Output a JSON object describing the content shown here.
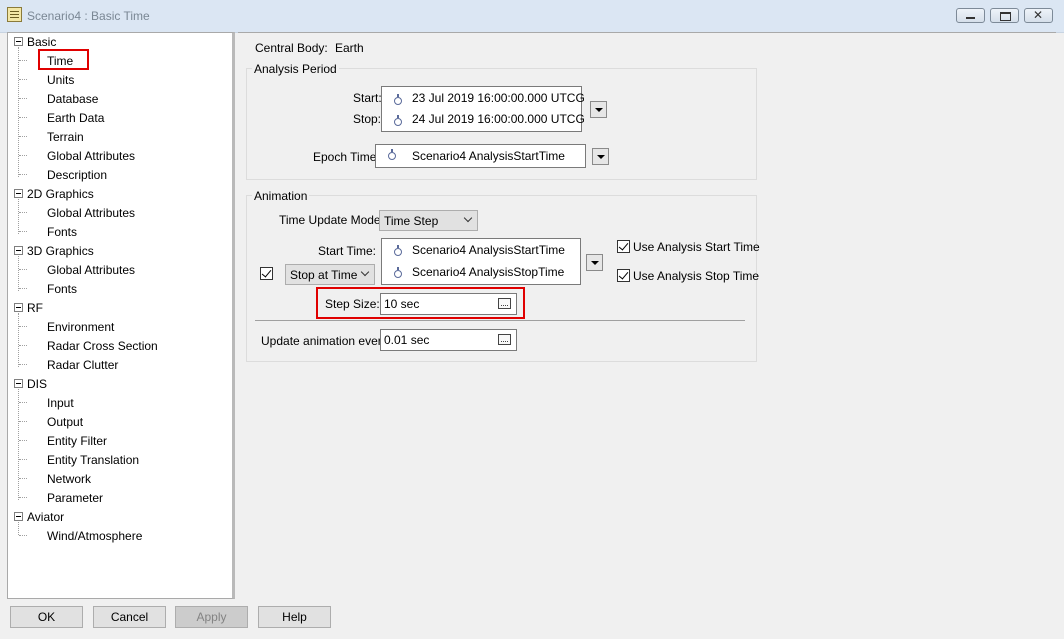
{
  "window": {
    "title": "Scenario4 : Basic Time"
  },
  "tree": [
    {
      "label": "Basic",
      "children": [
        "Time",
        "Units",
        "Database",
        "Earth Data",
        "Terrain",
        "Global Attributes",
        "Description"
      ]
    },
    {
      "label": "2D Graphics",
      "children": [
        "Global Attributes",
        "Fonts"
      ]
    },
    {
      "label": "3D Graphics",
      "children": [
        "Global Attributes",
        "Fonts"
      ]
    },
    {
      "label": "RF",
      "children": [
        "Environment",
        "Radar Cross Section",
        "Radar Clutter"
      ]
    },
    {
      "label": "DIS",
      "children": [
        "Input",
        "Output",
        "Entity Filter",
        "Entity Translation",
        "Network",
        "Parameter"
      ]
    },
    {
      "label": "Aviator",
      "children": [
        "Wind/Atmosphere"
      ]
    }
  ],
  "main": {
    "central_body_label": "Central Body:",
    "central_body_value": "Earth",
    "analysis_period": {
      "title": "Analysis Period",
      "start_label": "Start:",
      "start_value": "23 Jul 2019 16:00:00.000 UTCG",
      "stop_label": "Stop:",
      "stop_value": "24 Jul 2019 16:00:00.000 UTCG",
      "epoch_label": "Epoch Time:",
      "epoch_value": "Scenario4 AnalysisStartTime"
    },
    "animation": {
      "title": "Animation",
      "time_update_mode_label": "Time Update Mode:",
      "time_update_mode_value": "Time Step",
      "start_time_label": "Start Time:",
      "start_time_value": "Scenario4 AnalysisStartTime",
      "stop_mode_value": "Stop at Time",
      "stop_time_value": "Scenario4 AnalysisStopTime",
      "use_start_label": "Use Analysis Start Time",
      "use_stop_label": "Use Analysis Stop Time",
      "step_size_label": "Step Size:",
      "step_size_value": "10 sec",
      "update_every_label": "Update animation every:",
      "update_every_value": "0.01 sec"
    }
  },
  "buttons": {
    "ok": "OK",
    "cancel": "Cancel",
    "apply": "Apply",
    "help": "Help"
  },
  "icons": {
    "title": "document-icon",
    "tree_toggle": "collapse-icon",
    "time": "clock-icon",
    "dropdown": "dropdown-arrow-icon",
    "calculator": "calculator-icon"
  },
  "colors": {
    "highlight_box": "#e00000",
    "titlebar": "#dbe6f3"
  }
}
